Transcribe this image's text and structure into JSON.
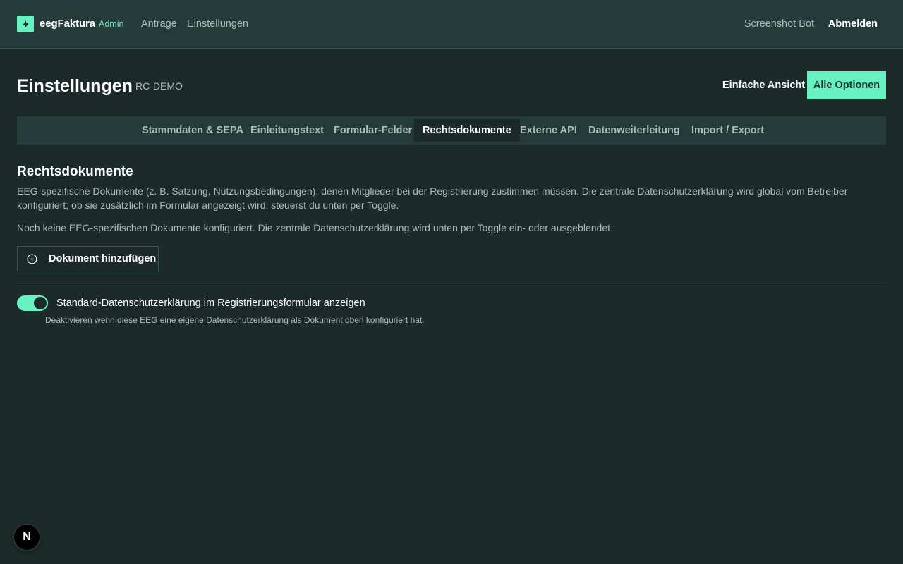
{
  "topbar": {
    "brand": "eegFaktura",
    "role": "Admin",
    "nav": [
      "Anträge",
      "Einstellungen"
    ],
    "user": "Screenshot Bot",
    "logout": "Abmelden",
    "logo_icon": "lightning-icon"
  },
  "header": {
    "title": "Einstellungen",
    "org_code": "RC-DEMO",
    "simple_view": "Einfache Ansicht",
    "all_options": "Alle Optionen"
  },
  "tabs": [
    "Stammdaten & SEPA",
    "Einleitungstext",
    "Formular-Felder",
    "Rechtsdokumente",
    "Externe API",
    "Datenweiterleitung",
    "Import / Export"
  ],
  "active_tab": "Rechtsdokumente",
  "section": {
    "title": "Rechtsdokumente",
    "description": "EEG-spezifische Dokumente (z. B. Satzung, Nutzungsbedingungen), denen Mitglieder bei der Registrierung zustimmen müssen. Die zentrale Datenschutzerklärung wird global vom Betreiber konfiguriert; ob sie zusätzlich im Formular angezeigt wird, steuerst du unten per Toggle.",
    "empty_note": "Noch keine EEG-spezifischen Dokumente konfiguriert. Die zentrale Datenschutzerklärung wird unten per Toggle ein- oder ausgeblendet.",
    "add_button": "Dokument hinzufügen",
    "add_icon": "plus-circle-icon"
  },
  "privacy_toggle": {
    "label": "Standard-Datenschutzerklärung im Registrierungsformular anzeigen",
    "help": "Deaktivieren wenn diese EEG eine eigene Datenschutzerklärung als Dokument oben konfiguriert hat.",
    "enabled": true
  },
  "dev_badge": "N",
  "colors": {
    "accent": "#67f0c0",
    "background": "#1c2a2a",
    "surface": "#243b39",
    "muted_text": "#a9bdb9"
  }
}
